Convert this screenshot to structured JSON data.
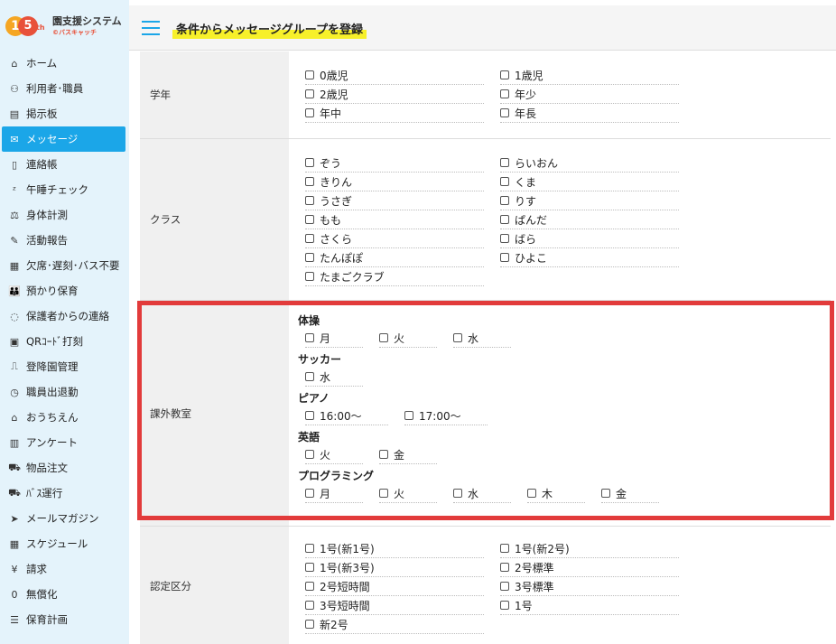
{
  "logo": {
    "num1": "1",
    "num2": "5",
    "suffix": "th",
    "title": "園支援システム",
    "sub": "©バスキャッチ"
  },
  "sidebar": {
    "items": [
      {
        "icon": "⌂",
        "label": "ホーム"
      },
      {
        "icon": "⚇",
        "label": "利用者･職員"
      },
      {
        "icon": "▤",
        "label": "掲示板"
      },
      {
        "icon": "✉",
        "label": "メッセージ",
        "active": true
      },
      {
        "icon": "▯",
        "label": "連絡帳"
      },
      {
        "icon": "ᶻ",
        "label": "午睡チェック"
      },
      {
        "icon": "⚖",
        "label": "身体計測"
      },
      {
        "icon": "✎",
        "label": "活動報告"
      },
      {
        "icon": "▦",
        "label": "欠席･遅刻･バス不要"
      },
      {
        "icon": "👪",
        "label": "預かり保育"
      },
      {
        "icon": "◌",
        "label": "保護者からの連絡"
      },
      {
        "icon": "▣",
        "label": "QRｺｰﾄﾞ打刻"
      },
      {
        "icon": "⎍",
        "label": "登降園管理"
      },
      {
        "icon": "◷",
        "label": "職員出退勤"
      },
      {
        "icon": "⌂",
        "label": "おうちえん"
      },
      {
        "icon": "▥",
        "label": "アンケート"
      },
      {
        "icon": "⛟",
        "label": "物品注文"
      },
      {
        "icon": "⛟",
        "label": "ﾊﾞｽ運行"
      },
      {
        "icon": "➤",
        "label": "メールマガジン"
      },
      {
        "icon": "▦",
        "label": "スケジュール"
      },
      {
        "icon": "¥",
        "label": "請求"
      },
      {
        "icon": "0",
        "label": "無償化"
      },
      {
        "icon": "☰",
        "label": "保育計画"
      }
    ]
  },
  "header": {
    "title": "条件からメッセージグループを登録"
  },
  "grade": {
    "label": "学年",
    "options": [
      "0歳児",
      "1歳児",
      "2歳児",
      "年少",
      "年中",
      "年長"
    ]
  },
  "class": {
    "label": "クラス",
    "options": [
      "ぞう",
      "らいおん",
      "きりん",
      "くま",
      "うさぎ",
      "りす",
      "もも",
      "ぱんだ",
      "さくら",
      "ばら",
      "たんぽぽ",
      "ひよこ",
      "たまごクラブ"
    ]
  },
  "extra": {
    "label": "課外教室",
    "groups": [
      {
        "title": "体操",
        "options": [
          "月",
          "火",
          "水"
        ]
      },
      {
        "title": "サッカー",
        "options": [
          "水"
        ]
      },
      {
        "title": "ピアノ",
        "options": [
          "16:00～",
          "17:00～"
        ]
      },
      {
        "title": "英語",
        "options": [
          "火",
          "金"
        ]
      },
      {
        "title": "プログラミング",
        "options": [
          "月",
          "火",
          "水",
          "木",
          "金"
        ]
      }
    ]
  },
  "cert": {
    "label": "認定区分",
    "options": [
      "1号(新1号)",
      "1号(新2号)",
      "1号(新3号)",
      "2号標準",
      "2号短時間",
      "3号標準",
      "3号短時間",
      "1号",
      "新2号"
    ]
  },
  "colors": {
    "accent": "#1ba6e8",
    "highlight_box": "#e23b3b",
    "title_marker": "#f7f02a"
  }
}
